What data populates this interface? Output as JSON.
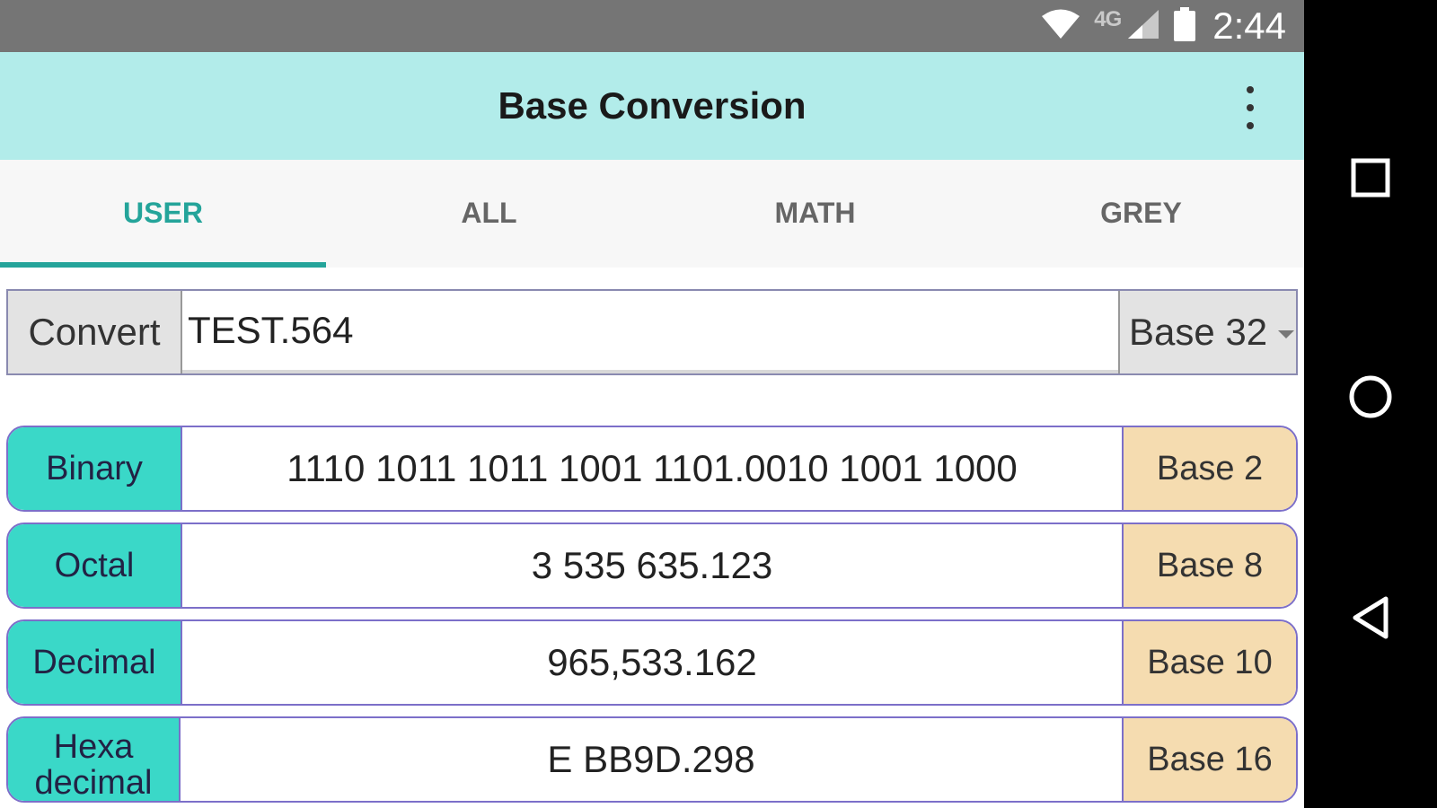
{
  "status_bar": {
    "network": "4G",
    "time": "2:44"
  },
  "app_bar": {
    "title": "Base Conversion"
  },
  "tabs": [
    {
      "label": "USER",
      "active": true
    },
    {
      "label": "ALL",
      "active": false
    },
    {
      "label": "MATH",
      "active": false
    },
    {
      "label": "GREY",
      "active": false
    }
  ],
  "converter": {
    "button_label": "Convert",
    "input_value": "TEST.564",
    "selected_base": "Base 32"
  },
  "results": [
    {
      "name": "Binary",
      "value": "1110 1011 1011 1001 1101.0010 1001 1000",
      "base": "Base 2"
    },
    {
      "name": "Octal",
      "value": "3 535 635.123",
      "base": "Base 8"
    },
    {
      "name": "Decimal",
      "value": "965,533.162",
      "base": "Base 10"
    },
    {
      "name": "Hexa decimal",
      "value": "E BB9D.298",
      "base": "Base 16"
    }
  ],
  "colors": {
    "app_bar": "#b2ecea",
    "accent": "#24a49a",
    "result_name_bg": "#3ad8c8",
    "result_base_bg": "#f5dcb0",
    "result_border": "#7c6fc9"
  },
  "icons": {
    "status": [
      "wifi-icon",
      "cell-signal-icon",
      "battery-icon"
    ],
    "app_bar": [
      "more-vert-icon"
    ],
    "nav": [
      "recents-square-icon",
      "home-circle-icon",
      "back-triangle-icon"
    ]
  }
}
